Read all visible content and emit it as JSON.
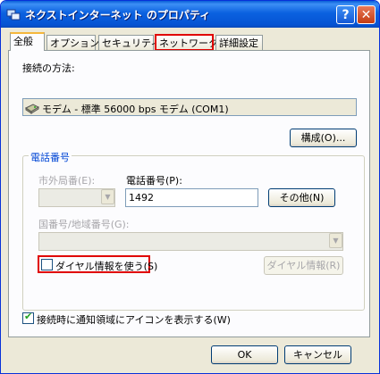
{
  "window": {
    "title": "ネクストインターネット のプロパティ",
    "help_label": "?",
    "close_label": "✕"
  },
  "tabs": [
    {
      "label": "全般",
      "active": true
    },
    {
      "label": "オプション"
    },
    {
      "label": "セキュリティ"
    },
    {
      "label": "ネットワーク",
      "highlighted": true
    },
    {
      "label": "詳細設定"
    }
  ],
  "connection": {
    "label": "接続の方法:",
    "modem_text": "モデム - 標準 56000 bps モデム (COM1)",
    "configure_label": "構成(O)..."
  },
  "phone": {
    "group_title": "電話番号",
    "area_code_label": "市外局番(E):",
    "area_code_value": "",
    "phone_label": "電話番号(P):",
    "phone_value": "1492",
    "other_label": "その他(N)",
    "country_label": "国番号/地域番号(G):",
    "country_value": "",
    "use_dialing_label": "ダイヤル情報を使う(S)",
    "use_dialing_checked": false,
    "dialing_rules_label": "ダイヤル情報(R)"
  },
  "notify": {
    "label": "接続時に通知領域にアイコンを表示する(W)",
    "checked": true
  },
  "footer": {
    "ok_label": "OK",
    "cancel_label": "キャンセル"
  },
  "colors": {
    "titlebar": "#0553d3",
    "highlight": "#e00000",
    "group_title": "#0046d5"
  }
}
